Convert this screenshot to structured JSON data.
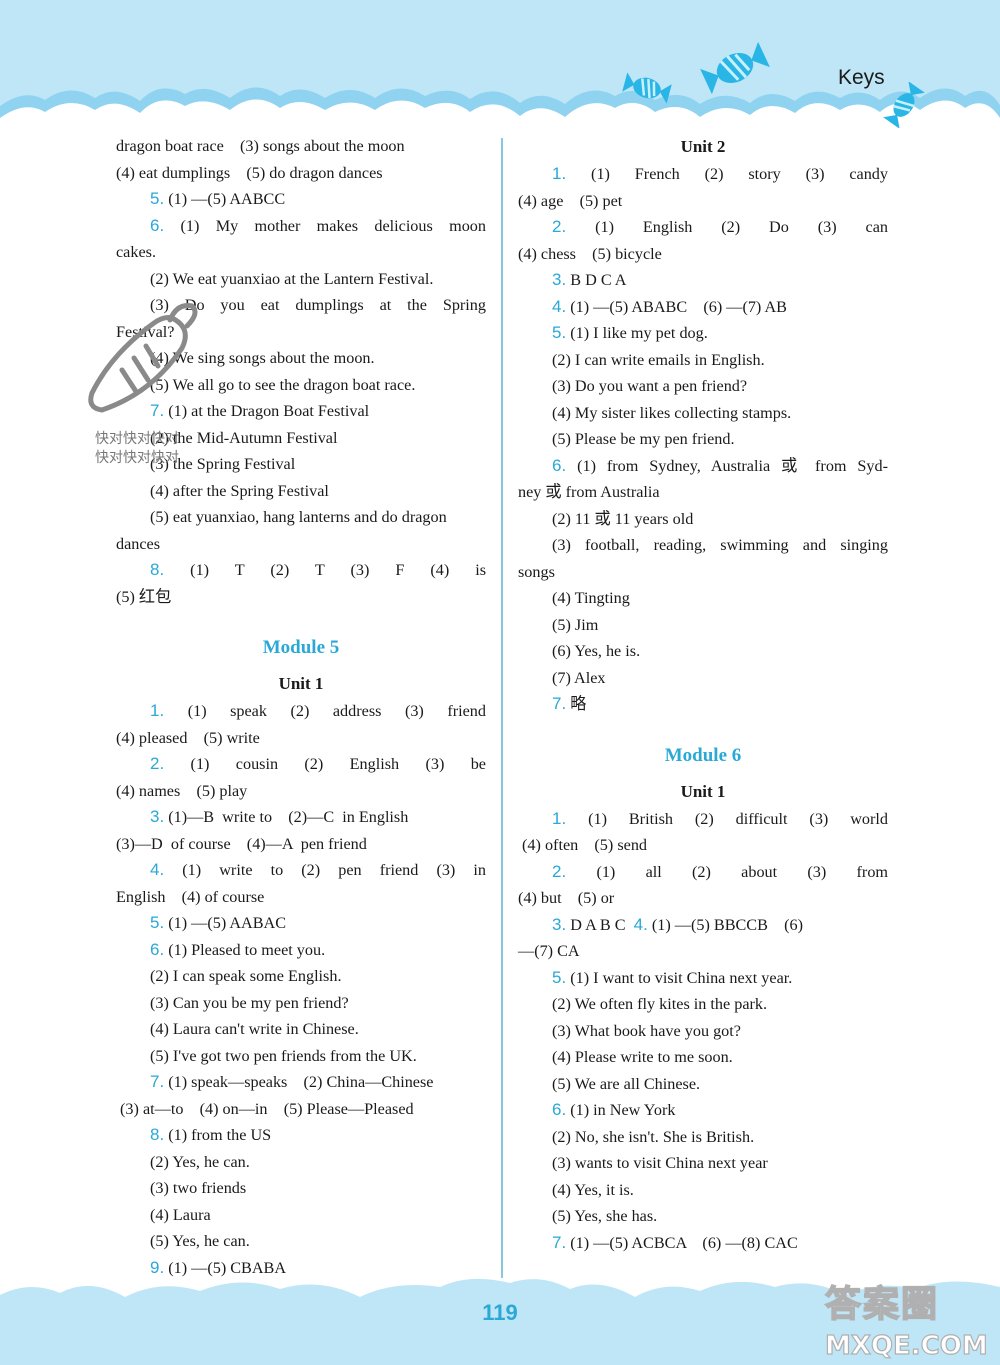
{
  "header": {
    "section_label": "Keys"
  },
  "footer": {
    "page_number": "119"
  },
  "colors": {
    "accent": "#2aa8d6",
    "band": "#bfe6f7",
    "wave": "#8fd3f1",
    "candy": "#29b6e6"
  },
  "watermarks": {
    "overlay_text_1": "快对快对快对",
    "overlay_text_2": "快对快对快对",
    "site_logo": "答案圈",
    "site_url": "MXQE.COM"
  },
  "left_column": {
    "lines": [
      {
        "text": "dragon boat race    (3) songs about the moon"
      },
      {
        "text": "(4) eat dumplings    (5) do dragon dances"
      },
      {
        "num": "5.",
        "text": " (1) —(5) AABCC",
        "indent": true
      },
      {
        "num": "6.",
        "text": " (1) My mother makes delicious moon",
        "indent": true,
        "justify": true
      },
      {
        "text": "cakes."
      },
      {
        "text": "(2) We eat yuanxiao at the Lantern Festival.",
        "indent": true
      },
      {
        "text": "(3) Do you eat dumplings at the Spring",
        "indent": true,
        "justify": true
      },
      {
        "text": "Festival?"
      },
      {
        "text": "(4) We sing songs about the moon.",
        "indent": true
      },
      {
        "text": "(5) We all go to see the dragon boat race.",
        "indent": true
      },
      {
        "num": "7.",
        "text": " (1) at the Dragon Boat Festival",
        "indent": true
      },
      {
        "text": "(2) the Mid-Autumn Festival",
        "indent": true
      },
      {
        "text": "(3) the Spring Festival",
        "indent": true
      },
      {
        "text": "(4) after the Spring Festival",
        "indent": true
      },
      {
        "text": "(5) eat yuanxiao, hang lanterns and do dragon",
        "indent": true
      },
      {
        "text": "dances"
      },
      {
        "num": "8.",
        "text": " (1) T    (2) T    (3) F    (4) is",
        "indent": true,
        "justify": true
      },
      {
        "text": "(5) 红包"
      }
    ],
    "module_title": "Module 5",
    "unit_title": "Unit 1",
    "unit_lines": [
      {
        "num": "1.",
        "text": " (1) speak    (2) address    (3) friend",
        "indent": true,
        "justify": true
      },
      {
        "text": "(4) pleased    (5) write"
      },
      {
        "num": "2.",
        "text": " (1) cousin    (2) English    (3) be",
        "indent": true,
        "justify": true
      },
      {
        "text": "(4) names    (5) play"
      },
      {
        "num": "3.",
        "text": " (1)—B  write to    (2)—C  in English",
        "indent": true
      },
      {
        "text": "(3)—D  of course    (4)—A  pen friend"
      },
      {
        "num": "4.",
        "text": " (1) write to    (2) pen friend    (3) in",
        "indent": true,
        "justify": true
      },
      {
        "text": "English    (4) of course"
      },
      {
        "num": "5.",
        "text": " (1) —(5) AABAC",
        "indent": true
      },
      {
        "num": "6.",
        "text": " (1) Pleased to meet you.",
        "indent": true
      },
      {
        "text": "(2) I can speak some English.",
        "indent": true
      },
      {
        "text": "(3) Can you be my pen friend?",
        "indent": true
      },
      {
        "text": "(4) Laura can't write in Chinese.",
        "indent": true
      },
      {
        "text": "(5) I've got two pen friends from the UK.",
        "indent": true
      },
      {
        "num": "7.",
        "text": " (1) speak—speaks    (2) China—Chinese",
        "indent": true
      },
      {
        "text": " (3) at—to    (4) on—in    (5) Please—Pleased"
      },
      {
        "num": "8.",
        "text": " (1) from the US",
        "indent": true
      },
      {
        "text": "(2) Yes, he can.",
        "indent": true
      },
      {
        "text": "(3) two friends",
        "indent": true
      },
      {
        "text": "(4) Laura",
        "indent": true
      },
      {
        "text": "(5) Yes, he can.",
        "indent": true
      },
      {
        "num": "9.",
        "text": " (1) —(5) CBABA",
        "indent": true
      }
    ]
  },
  "right_column": {
    "unit2_title": "Unit 2",
    "unit2_lines": [
      {
        "num": "1.",
        "text": " (1) French    (2) story    (3) candy",
        "indent": true,
        "justify": true
      },
      {
        "text": "(4) age    (5) pet"
      },
      {
        "num": "2.",
        "text": " (1) English    (2) Do    (3) can",
        "indent": true,
        "justify": true
      },
      {
        "text": "(4) chess    (5) bicycle"
      },
      {
        "num": "3.",
        "text": " B D C A",
        "indent": true
      },
      {
        "num": "4.",
        "text": " (1) —(5) ABABC    (6) —(7) AB",
        "indent": true
      },
      {
        "num": "5.",
        "text": " (1) I like my pet dog.",
        "indent": true
      },
      {
        "text": "(2) I can write emails in English.",
        "indent": true
      },
      {
        "text": "(3) Do you want a pen friend?",
        "indent": true
      },
      {
        "text": "(4) My sister likes collecting stamps.",
        "indent": true
      },
      {
        "text": "(5) Please be my pen friend.",
        "indent": true
      },
      {
        "num": "6.",
        "text": " (1) from Sydney, Australia 或 from Syd-",
        "indent": true,
        "justify": true
      },
      {
        "text": "ney 或 from Australia"
      },
      {
        "text": "(2) 11 或 11 years old",
        "indent": true
      },
      {
        "text": "(3) football, reading, swimming and singing",
        "indent": true,
        "justify": true
      },
      {
        "text": "songs"
      },
      {
        "text": "(4) Tingting",
        "indent": true
      },
      {
        "text": "(5) Jim",
        "indent": true
      },
      {
        "text": "(6) Yes, he is.",
        "indent": true
      },
      {
        "text": "(7) Alex",
        "indent": true
      },
      {
        "num": "7.",
        "text": " 略",
        "indent": true
      }
    ],
    "module_title": "Module 6",
    "unit_title": "Unit 1",
    "unit_lines": [
      {
        "num": "1.",
        "text": " (1) British    (2) difficult    (3) world",
        "indent": true,
        "justify": true
      },
      {
        "text": " (4) often    (5) send"
      },
      {
        "num": "2.",
        "text": " (1) all    (2) about    (3) from",
        "indent": true,
        "justify": true
      },
      {
        "text": "(4) but    (5) or"
      },
      {
        "num": "3.",
        "text": " D A B C  ",
        "num2": "4.",
        "text2": " (1) —(5) BBCCB    (6)",
        "indent": true
      },
      {
        "text": "—(7) CA"
      },
      {
        "num": "5.",
        "text": " (1) I want to visit China next year.",
        "indent": true
      },
      {
        "text": "(2) We often fly kites in the park.",
        "indent": true
      },
      {
        "text": "(3) What book have you got?",
        "indent": true
      },
      {
        "text": "(4) Please write to me soon.",
        "indent": true
      },
      {
        "text": "(5) We are all Chinese.",
        "indent": true
      },
      {
        "num": "6.",
        "text": " (1) in New York",
        "indent": true
      },
      {
        "text": "(2) No, she isn't. She is British.",
        "indent": true
      },
      {
        "text": "(3) wants to visit China next year",
        "indent": true
      },
      {
        "text": "(4) Yes, it is.",
        "indent": true
      },
      {
        "text": "(5) Yes, she has.",
        "indent": true
      },
      {
        "num": "7.",
        "text": " (1) —(5) ACBCA    (6) —(8) CAC",
        "indent": true
      }
    ]
  }
}
